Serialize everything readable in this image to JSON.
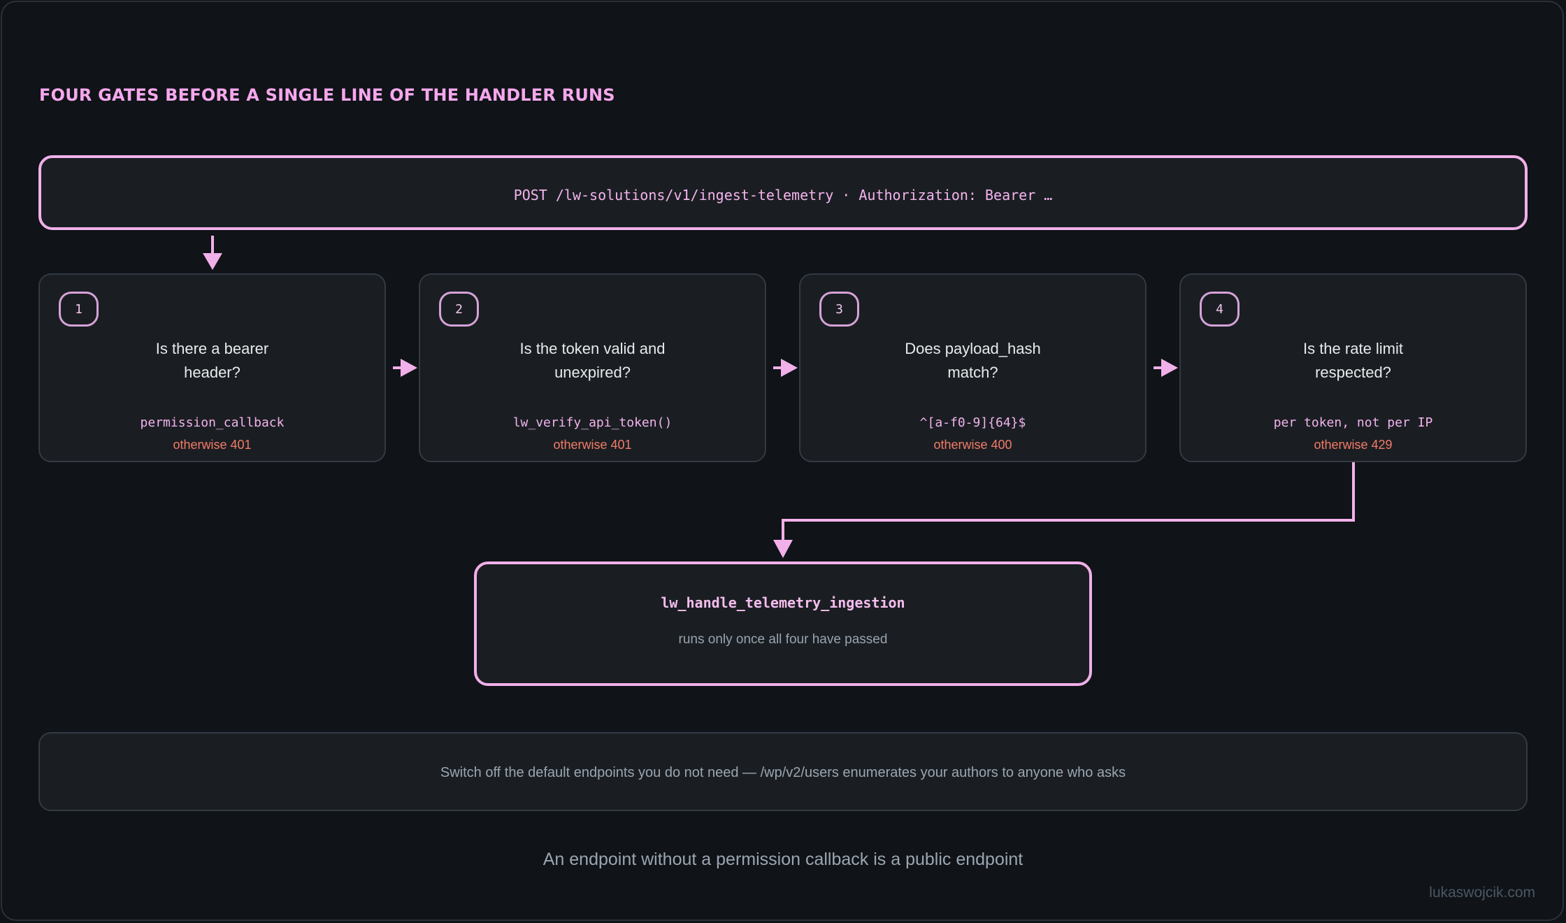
{
  "diagram": {
    "title": "FOUR GATES BEFORE A SINGLE LINE OF THE HANDLER RUNS",
    "request": "POST /lw-solutions/v1/ingest-telemetry · Authorization: Bearer …",
    "gates": [
      {
        "number": "1",
        "question_line1": "Is there a bearer",
        "question_line2": "header?",
        "code": "permission_callback",
        "failure": "otherwise 401"
      },
      {
        "number": "2",
        "question_line1": "Is the token valid and",
        "question_line2": "unexpired?",
        "code": "lw_verify_api_token()",
        "failure": "otherwise 401"
      },
      {
        "number": "3",
        "question_line1": "Does payload_hash",
        "question_line2": "match?",
        "code": "^[a-f0-9]{64}$",
        "failure": "otherwise 400"
      },
      {
        "number": "4",
        "question_line1": "Is the rate limit",
        "question_line2": "respected?",
        "code": "per token, not per IP",
        "failure": "otherwise 429"
      }
    ],
    "handler": {
      "name": "lw_handle_telemetry_ingestion",
      "note": "runs only once all four have passed"
    },
    "tip": "Switch off the default endpoints you do not need — /wp/v2/users enumerates your authors to anyone who asks",
    "tagline": "An endpoint without a permission callback is a public endpoint",
    "watermark": "lukaswojcik.com",
    "colors": {
      "accent": "#f1b0ea",
      "error": "#f37b68",
      "background": "#101317",
      "panel": "#1a1e22"
    }
  }
}
